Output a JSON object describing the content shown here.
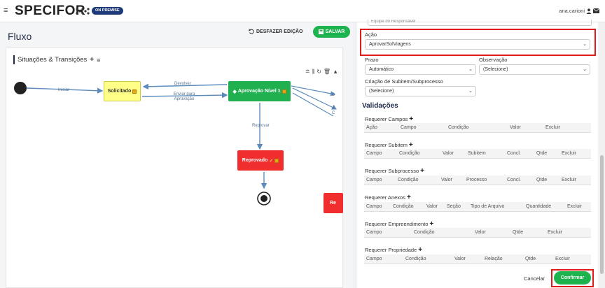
{
  "header": {
    "brand": "SPECIFOR",
    "badge": "ON PREMISE",
    "user": "ana.carioni",
    "icons": [
      "hamburger-icon",
      "user-icon",
      "mail-icon"
    ]
  },
  "left": {
    "title": "Fluxo",
    "undo_label": "DESFAZER EDIÇÃO",
    "save_label": "SALVAR",
    "section_title": "Situações & Transições",
    "nodes": {
      "solicitado": "Solicitado",
      "aprovacao": "Aprovação Nível 1",
      "reprovado": "Reprovado",
      "partial": "Re"
    },
    "edges": {
      "iniciar": "Iniciar",
      "devolver": "Devolver",
      "enviar": "Enviar para Aprovação",
      "reprovar": "Reprovar",
      "d": "D",
      "a": "A",
      "c": "C"
    }
  },
  "right": {
    "cut_text": "Equipe do Responsável",
    "acao_label": "Ação",
    "acao_value": "AprovarSolViagens",
    "prazo_label": "Prazo",
    "prazo_value": "Automático",
    "obs_label": "Observação",
    "obs_value": "(Selecione)",
    "criacao_label": "Criação de Subitem/Subprocesso",
    "criacao_value": "(Selecione)",
    "validacoes": "Validações",
    "requirements": [
      {
        "title": "Requerer Campos",
        "cols": [
          "Ação",
          "Campo",
          "Condição",
          "Valor",
          "Excluir"
        ]
      },
      {
        "title": "Requerer Subitem",
        "cols": [
          "Campo",
          "Condição",
          "Valor",
          "Subitem",
          "Concl.",
          "Qtde",
          "Excluir"
        ]
      },
      {
        "title": "Requerer Subprocesso",
        "cols": [
          "Campo",
          "Condição",
          "Valor",
          "Processo",
          "Concl.",
          "Qtde",
          "Excluir"
        ]
      },
      {
        "title": "Requerer Anexos",
        "cols": [
          "Campo",
          "Condição",
          "Valor",
          "Seção",
          "Tipo de Arquivo",
          "Quantidade",
          "Excluir"
        ]
      },
      {
        "title": "Requerer Empreendimento",
        "cols": [
          "Campo",
          "Condição",
          "Valor",
          "Qtde",
          "Excluir"
        ]
      },
      {
        "title": "Requerer Propriedade",
        "cols": [
          "Campo",
          "Condição",
          "Valor",
          "Relação",
          "Qtde",
          "Excluir"
        ]
      }
    ],
    "cancel_label": "Cancelar",
    "confirm_label": "Confirmar"
  },
  "colors": {
    "green": "#1db34f",
    "navy": "#1e2a4a",
    "highlight": "#e01b1b",
    "yellow_node": "#ffff88",
    "red_node": "#f02e2e"
  }
}
